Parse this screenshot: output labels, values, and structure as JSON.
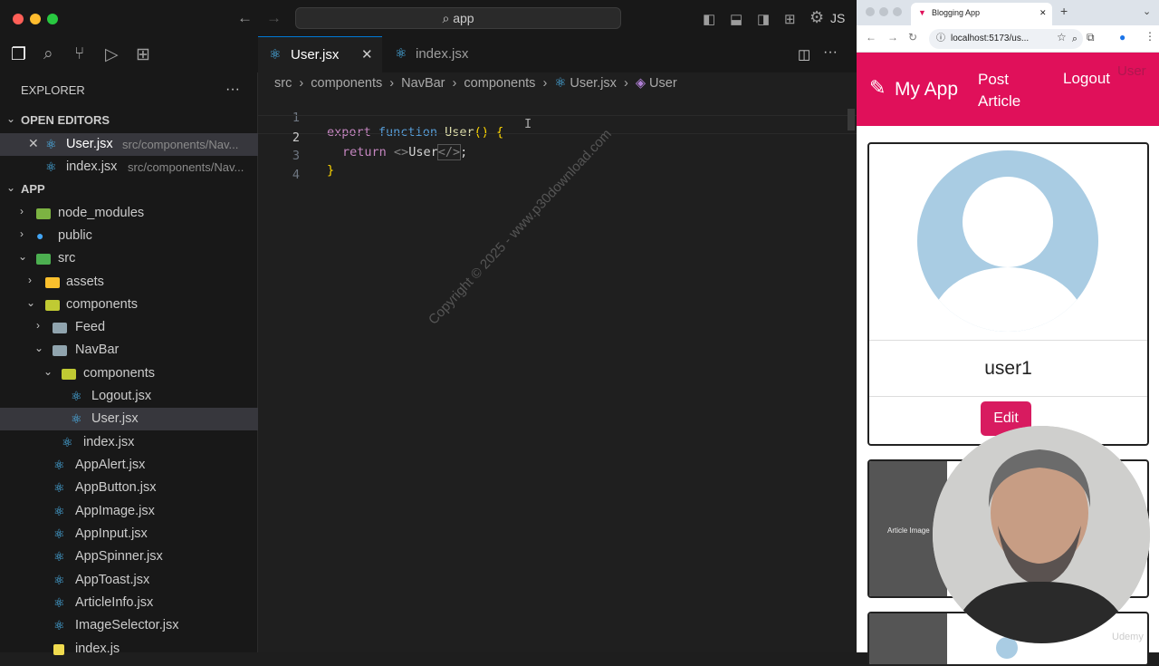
{
  "vscode": {
    "command_center": "app",
    "lang_badge": "JS",
    "explorer": {
      "title": "EXPLORER",
      "more": "···",
      "open_editors_title": "OPEN EDITORS",
      "open_editors": [
        {
          "name": "User.jsx",
          "path": "src/components/Nav..."
        },
        {
          "name": "index.jsx",
          "path": "src/components/Nav..."
        }
      ],
      "app_title": "APP",
      "tree": [
        {
          "label": "node_modules"
        },
        {
          "label": "public"
        },
        {
          "label": "src"
        },
        {
          "label": "assets"
        },
        {
          "label": "components"
        },
        {
          "label": "Feed"
        },
        {
          "label": "NavBar"
        },
        {
          "label": "components"
        },
        {
          "label": "Logout.jsx"
        },
        {
          "label": "User.jsx"
        },
        {
          "label": "index.jsx"
        },
        {
          "label": "AppAlert.jsx"
        },
        {
          "label": "AppButton.jsx"
        },
        {
          "label": "AppImage.jsx"
        },
        {
          "label": "AppInput.jsx"
        },
        {
          "label": "AppSpinner.jsx"
        },
        {
          "label": "AppToast.jsx"
        },
        {
          "label": "ArticleInfo.jsx"
        },
        {
          "label": "ImageSelector.jsx"
        },
        {
          "label": "index.js"
        }
      ]
    },
    "tabs": [
      {
        "label": "User.jsx"
      },
      {
        "label": "index.jsx"
      }
    ],
    "breadcrumb": [
      "src",
      "components",
      "NavBar",
      "components",
      "User.jsx",
      "User"
    ],
    "code": {
      "line_numbers": [
        "1",
        "2",
        "3",
        "4"
      ],
      "l1_export": "export",
      "l1_function": "function",
      "l1_name": "User",
      "l1_parens": "()",
      "l1_brace": "{",
      "l2_return": "return",
      "l2_open": "<>",
      "l2_text": "User",
      "l2_close": "</>",
      "l2_semi": ";",
      "l3_brace": "}"
    },
    "watermark": "Copyright © 2025 - www.p30download.com"
  },
  "browser": {
    "tab_title": "Blogging App",
    "url": "localhost:5173/us...",
    "app": {
      "brand": "My App",
      "nav_post": "Post Article",
      "nav_logout": "Logout",
      "nav_user": "User",
      "username": "user1",
      "edit_button": "Edit",
      "article_image_alt": "Article Image"
    },
    "corner_mark": "Udemy"
  },
  "colors": {
    "brand": "#e0105a",
    "avatar": "#a9cce3",
    "react": "#4fc1ff"
  }
}
